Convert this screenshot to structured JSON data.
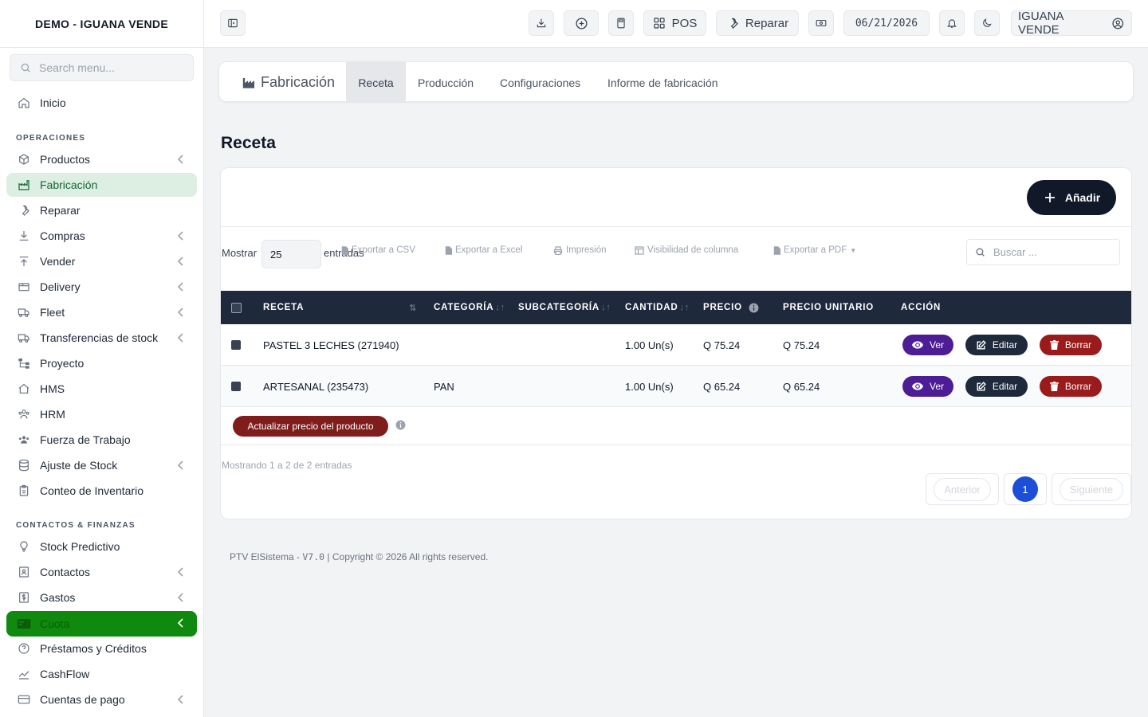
{
  "app": {
    "brand": "DEMO - IGUANA VENDE"
  },
  "sidebar": {
    "search_placeholder": "Search menu...",
    "home": "Inicio",
    "section_operations": "OPERACIONES",
    "section_contacts": "CONTACTOS & FINANZAS",
    "items": {
      "productos": "Productos",
      "fabricacion": "Fabricación",
      "reparar": "Reparar",
      "compras": "Compras",
      "vender": "Vender",
      "delivery": "Delivery",
      "fleet": "Fleet",
      "transferencias": "Transferencias de stock",
      "proyecto": "Proyecto",
      "hms": "HMS",
      "hrm": "HRM",
      "fuerza": "Fuerza de Trabajo",
      "ajuste": "Ajuste de Stock",
      "conteo": "Conteo de Inventario",
      "stock_predictivo": "Stock Predictivo",
      "contactos": "Contactos",
      "gastos": "Gastos",
      "cuota": "Cuota",
      "prestamos": "Préstamos y Créditos",
      "cashflow": "CashFlow",
      "cuentas": "Cuentas de pago"
    }
  },
  "topbar": {
    "pos_label": "POS",
    "repair_label": "Reparar",
    "date": "06/21/2026",
    "user": "IGUANA VENDE"
  },
  "tabs": {
    "module": "Fabricación",
    "receta": "Receta",
    "produccion": "Producción",
    "configuraciones": "Configuraciones",
    "informe": "Informe de fabricación"
  },
  "page": {
    "title": "Receta"
  },
  "toolbar": {
    "add_label": "Añadir",
    "show_label": "Mostrar",
    "show_value": "25",
    "entries_label": "entradas",
    "export_csv": "Exportar a CSV",
    "export_excel": "Exportar a Excel",
    "print": "Impresión",
    "column_visibility": "Visibilidad de columna",
    "export_pdf": "Exportar a PDF",
    "search_placeholder": "Buscar ..."
  },
  "table": {
    "headers": {
      "receta": "RECETA",
      "categoria": "CATEGORÍA",
      "subcategoria": "SUBCATEGORÍA",
      "cantidad": "CANTIDAD",
      "precio": "PRECIO",
      "precio_unitario": "PRECIO UNITARIO",
      "accion": "ACCIÓN"
    },
    "rows": [
      {
        "receta": "PASTEL 3 LECHES (271940)",
        "categoria": "",
        "subcategoria": "",
        "cantidad": "1.00 Un(s)",
        "precio": "Q 75.24",
        "precio_unitario": "Q 75.24"
      },
      {
        "receta": "ARTESANAL (235473)",
        "categoria": "PAN",
        "subcategoria": "",
        "cantidad": "1.00 Un(s)",
        "precio": "Q 65.24",
        "precio_unitario": "Q 65.24"
      }
    ],
    "actions": {
      "view": "Ver",
      "edit": "Editar",
      "delete": "Borrar"
    }
  },
  "update_price_label": "Actualizar precio del producto",
  "pagination": {
    "showing": "Mostrando 1 a 2 de 2 entradas",
    "previous": "Anterior",
    "current": "1",
    "next": "Siguiente"
  },
  "footer": {
    "app": "PTV ElSistema - ",
    "version": "V7.0",
    "copyright": " | Copyright © 2026 All rights reserved."
  },
  "colors": {
    "active_nav_bg": "#dcefe2",
    "highlight_nav_bg": "#0f8a0f",
    "table_header": "#1e293b",
    "view_button": "#4c1d95",
    "delete_button": "#991b1b",
    "page_active": "#1d4ed8"
  }
}
